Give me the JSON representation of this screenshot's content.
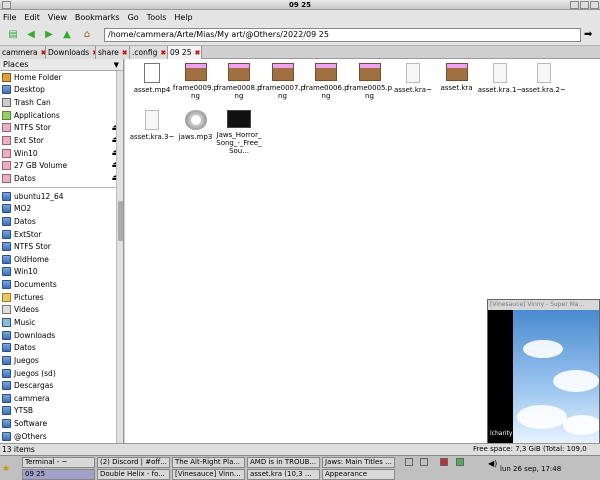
{
  "window": {
    "title": "09 25"
  },
  "menu": [
    "File",
    "Edit",
    "View",
    "Bookmarks",
    "Go",
    "Tools",
    "Help"
  ],
  "location": {
    "path": "/home/cammera/Arte/Mias/My art/@Others/2022/09 25"
  },
  "tabs": [
    {
      "label": "cammera",
      "active": false
    },
    {
      "label": "Downloads",
      "active": false
    },
    {
      "label": "share",
      "active": false
    },
    {
      "label": ".config",
      "active": false
    },
    {
      "label": "09 25",
      "active": true
    }
  ],
  "sidebar": {
    "header": "Places",
    "items": [
      {
        "label": "Home Folder",
        "icon": "home"
      },
      {
        "label": "Desktop",
        "icon": "folder"
      },
      {
        "label": "Trash Can",
        "icon": "trash"
      },
      {
        "label": "Applications",
        "icon": "app"
      },
      {
        "label": "NTFS Stor",
        "icon": "drive",
        "eject": true
      },
      {
        "label": "Ext Stor",
        "icon": "drive",
        "eject": true
      },
      {
        "label": "Win10",
        "icon": "drive",
        "eject": true
      },
      {
        "label": "27 GB Volume",
        "icon": "drive",
        "eject": true
      },
      {
        "label": "Datos",
        "icon": "drive",
        "eject": true
      }
    ],
    "bookmarks": [
      {
        "label": "ubuntu12_64",
        "icon": "folder"
      },
      {
        "label": "MO2",
        "icon": "folder"
      },
      {
        "label": "Datos",
        "icon": "folder"
      },
      {
        "label": "ExtStor",
        "icon": "folder"
      },
      {
        "label": "NTFS Stor",
        "icon": "folder"
      },
      {
        "label": "OldHome",
        "icon": "folder"
      },
      {
        "label": "Win10",
        "icon": "folder"
      },
      {
        "label": "Documents",
        "icon": "folder"
      },
      {
        "label": "Pictures",
        "icon": "yellow"
      },
      {
        "label": "Videos",
        "icon": "video"
      },
      {
        "label": "Music",
        "icon": "music"
      },
      {
        "label": "Downloads",
        "icon": "folder"
      },
      {
        "label": "Datos",
        "icon": "folder"
      },
      {
        "label": "Juegos",
        "icon": "folder"
      },
      {
        "label": "Juegos (sd)",
        "icon": "folder"
      },
      {
        "label": "Descargas",
        "icon": "folder"
      },
      {
        "label": "cammera",
        "icon": "folder"
      },
      {
        "label": "YTSB",
        "icon": "folder"
      },
      {
        "label": "Software",
        "icon": "folder"
      },
      {
        "label": "@Others",
        "icon": "folder"
      }
    ]
  },
  "files": [
    {
      "name": "asset.mp4",
      "type": "video"
    },
    {
      "name": "frame0009.png",
      "type": "frame"
    },
    {
      "name": "frame0008.png",
      "type": "frame"
    },
    {
      "name": "frame0007.png",
      "type": "frame"
    },
    {
      "name": "frame0006.png",
      "type": "frame"
    },
    {
      "name": "frame0005.png",
      "type": "frame"
    },
    {
      "name": "asset.kra~",
      "type": "doc"
    },
    {
      "name": "asset.kra",
      "type": "kra"
    },
    {
      "name": "asset.kra.1~",
      "type": "doc"
    },
    {
      "name": "asset.kra.2~",
      "type": "doc"
    },
    {
      "name": "asset.kra.3~",
      "type": "doc"
    },
    {
      "name": "jaws.mp3",
      "type": "audio"
    },
    {
      "name": "Jaws_Horror_Song_-_Free_Sou...",
      "type": "dark"
    }
  ],
  "status": {
    "count": "13 items",
    "free": "Free space: 7,3 GiB (Total: 109,0 GiB)"
  },
  "taskbar": {
    "row1": [
      "Terminal - ~",
      "(2) Discord | #off...",
      "The Alt-Right Pla...",
      "AMD is in TROUB...",
      "Jaws: Main Titles ..."
    ],
    "row2": [
      "09 25",
      "Double Helix - fo...",
      "[Vinesauce] Vinn...",
      "asset.kra (10,3 ...",
      "Appearance"
    ],
    "clock": "lun 26 sep, 17:48"
  },
  "game_window": {
    "title": "[Vinesauce] Vinny - Super Ma...",
    "channel": "lcharity"
  }
}
